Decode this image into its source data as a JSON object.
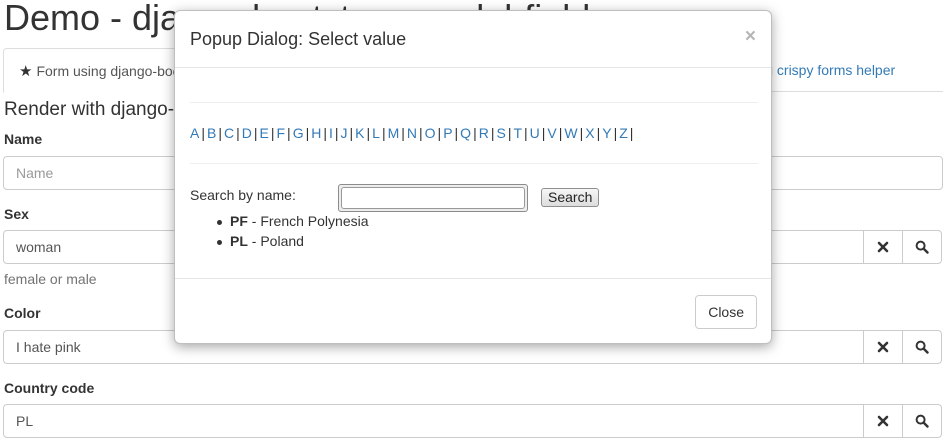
{
  "page": {
    "title": "Demo - django-bootstrap-modal-fields",
    "tabs": {
      "active_label": "Form using django-bootstrap",
      "other_label": "Form using crispy forms helper"
    },
    "section_title": "Render with django-bootstrap3",
    "fields": {
      "name": {
        "label": "Name",
        "placeholder": "Name"
      },
      "sex": {
        "label": "Sex",
        "value": "woman",
        "help": "female or male"
      },
      "color": {
        "label": "Color",
        "value": "I hate pink"
      },
      "country": {
        "label": "Country code",
        "value": "PL"
      }
    },
    "icons": {
      "clear": "times-icon",
      "search": "search-icon"
    }
  },
  "modal": {
    "title": "Popup Dialog: Select value",
    "close_x": "×",
    "letters": [
      "A",
      "B",
      "C",
      "D",
      "E",
      "F",
      "G",
      "H",
      "I",
      "J",
      "K",
      "L",
      "M",
      "N",
      "O",
      "P",
      "Q",
      "R",
      "S",
      "T",
      "U",
      "V",
      "W",
      "X",
      "Y",
      "Z"
    ],
    "alphabet_trailing_sep": "|",
    "search_label": "Search by name:",
    "search_value": "",
    "search_button": "Search",
    "results": [
      {
        "code": "PF",
        "name": " - French Polynesia"
      },
      {
        "code": "PL",
        "name": " - Poland"
      }
    ],
    "close_button": "Close"
  },
  "colors": {
    "link": "#337ab7",
    "text": "#333333",
    "muted": "#737373",
    "border": "#cccccc"
  }
}
